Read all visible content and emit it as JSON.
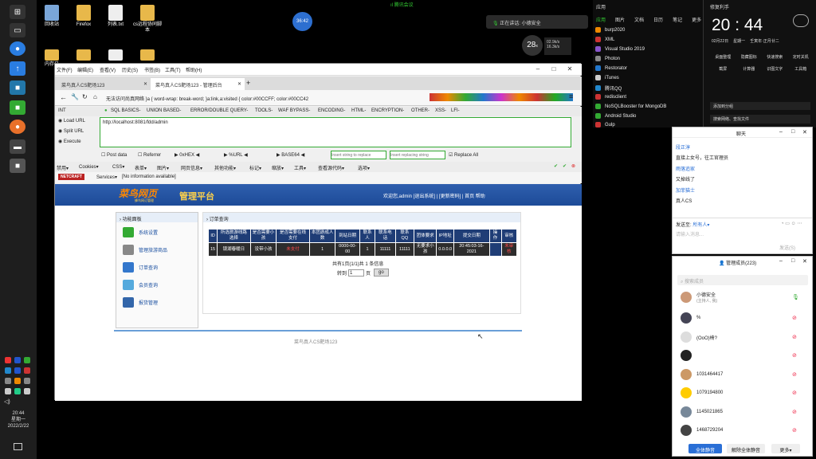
{
  "taskbar": {
    "time": "20:44",
    "weekday": "星期一",
    "date": "2022/2/22"
  },
  "desktop": {
    "icons": [
      "回收站",
      "Firefox",
      "列表.txt",
      "cs远程协同脚本",
      "内存马",
      "jsp"
    ],
    "float_badge": "36:42",
    "speaking": "正在讲话: 小德安全",
    "speed_num": "28",
    "speed_unit": "x",
    "speed_up": "02.9k/s",
    "speed_down": "16.3k/s",
    "meeting": "腾讯会议"
  },
  "browser": {
    "menu": [
      "文件(F)",
      "编辑(E)",
      "查看(V)",
      "历史(S)",
      "书签(B)",
      "工具(T)",
      "帮助(H)"
    ],
    "tabs": [
      "菜鸟真人CS靶场123",
      "菜鸟真人CS靶场123 - 管理后台"
    ],
    "new_tab": "+",
    "url_text": "无法访问尚真网络 }a { word-wrap: break-word; }a:link,a:visited { color:#00CCFF; color:#00CC42",
    "hackbar_select": "INT",
    "hackbar_menu": [
      "SQL BASICS-",
      "UNION BASED-",
      "ERROR/DOUBLE QUERY-",
      "TOOLS-",
      "WAF BYPASS-",
      "ENCODING-",
      "HTML-",
      "ENCRYPTION-",
      "OTHER-",
      "XSS-",
      "LFI-"
    ],
    "load_url": "Load URL",
    "split_url": "Split URL",
    "execute": "Execute",
    "hackbar_url": "http://localhost:8081/fdd/admin",
    "post_data": "Post data",
    "referrer": "Referrer",
    "hex": "0xHEX",
    "urlenc": "%URL",
    "base64": "BASE64",
    "insert_string": "Insert string to replace",
    "insert_replacing": "Insert replacing string",
    "replace_all": "Replace All",
    "bookmarks": [
      "禁用▾",
      "Cookies▾",
      "CSS▾",
      "表单▾",
      "图片▾",
      "网页信息▾",
      "其他功能▾",
      "标记▾",
      "缩放▾",
      "工具▾",
      "查看源代码▾",
      "选项▾"
    ],
    "netcraft": "NETCRAFT",
    "services": "Services▾",
    "no_info": "[No information available]"
  },
  "site": {
    "logo": "菜鸟网页",
    "logo_sub": "蜂鸟网订管理",
    "title": "管理平台",
    "welcome": "欢迎您,admin [退出系统] | [更新密码] | 首页 帮助",
    "panel_title": "功能面板",
    "side": [
      "系统设置",
      "管理旅游商品",
      "订单查询",
      "会员查询",
      "报货管理"
    ],
    "section_title": "订单查询",
    "columns": [
      "ID",
      "所选旅游线路选择",
      "是否需要小孩",
      "是否需要在线支付",
      "本团游成人数",
      "到站日期",
      "联系人",
      "联系电话",
      "联系QQ",
      "团体要求",
      "IP地址",
      "提交日期",
      "操作",
      "审核"
    ],
    "row": [
      "15",
      "镜湖春暖日",
      "没带小孩",
      "未支付",
      "1",
      "0000-00-00",
      "1",
      "11111",
      "11111",
      "无要求小孩",
      "0.0.0.0",
      "20:45:03-16-2021",
      "",
      "未审核"
    ],
    "pager": "共有1页(1/1)共 1 条信息",
    "jump_label": "转到",
    "jump_value": "1",
    "page_suffix": "页",
    "go": "go",
    "footer": "菜鸟真人CS靶场123"
  },
  "right_panel": {
    "tabs": [
      "应用",
      "图片",
      "文档",
      "日历",
      "笔记",
      "更多"
    ],
    "time": "20 : 44",
    "date": "02月22日",
    "weekday": "星期一",
    "lunar": "壬寅年·正月廿二",
    "apps": [
      "burp2020",
      "XML",
      "Visual Studio 2019",
      "Photon",
      "Restorator",
      "iTunes",
      "腾讯QQ",
      "redisclient",
      "NoSQLBooster for MongoDB",
      "Android Studio",
      "Gulp"
    ],
    "tools": [
      "桌面整理",
      "隐藏图标",
      "快速搜索",
      "定时关机",
      "截屏",
      "计算器",
      "识图文字",
      "工具箱"
    ],
    "buttons": [
      "添加到分组",
      "搜索网络、查找文件"
    ]
  },
  "chat": {
    "title": "聊天",
    "messages": [
      {
        "name": "段正淳",
        "text": "直接上女号，往工官理员"
      },
      {
        "name": "雨落追家",
        "text": "又掉线了"
      },
      {
        "name": "加菲猫士",
        "text": "真人CS"
      }
    ],
    "send_to_label": "发送至:",
    "send_to": "所有人▾",
    "input_placeholder": "请输入消息...",
    "send": "发送(S)"
  },
  "group": {
    "title": "管理成员(223)",
    "search": "搜索成员",
    "members": [
      "小德安全",
      "(主持人, 我)",
      "%",
      "(OoO)椅?",
      "",
      "1031464417",
      "1079194800",
      "1145021865",
      "1468729204"
    ],
    "mute_all": "全体静音",
    "unmute_all": "解除全体静音",
    "more": "更多▾"
  },
  "colors": {
    "banner": "#1d4b98",
    "header": "#1f3d76",
    "accent": "#2f6fd0"
  }
}
